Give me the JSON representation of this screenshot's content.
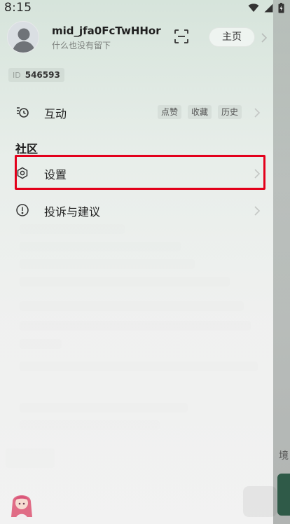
{
  "status_bar": {
    "time": "8:15"
  },
  "profile": {
    "username": "mid_jfa0FcTwHHor",
    "bio": "什么也没有留下",
    "home_button": "主页",
    "id_label": "ID",
    "id_value": "546593"
  },
  "menu": {
    "interact": {
      "label": "互动",
      "chips": [
        "点赞",
        "收藏",
        "历史"
      ]
    },
    "section_title": "社区",
    "settings": {
      "label": "设置"
    },
    "feedback": {
      "label": "投诉与建议"
    }
  },
  "background": {
    "peek_text": "境"
  },
  "colors": {
    "highlight": "#e3001b",
    "drawer_top": "#d6e4db",
    "accent_dark": "#2f5a48"
  }
}
